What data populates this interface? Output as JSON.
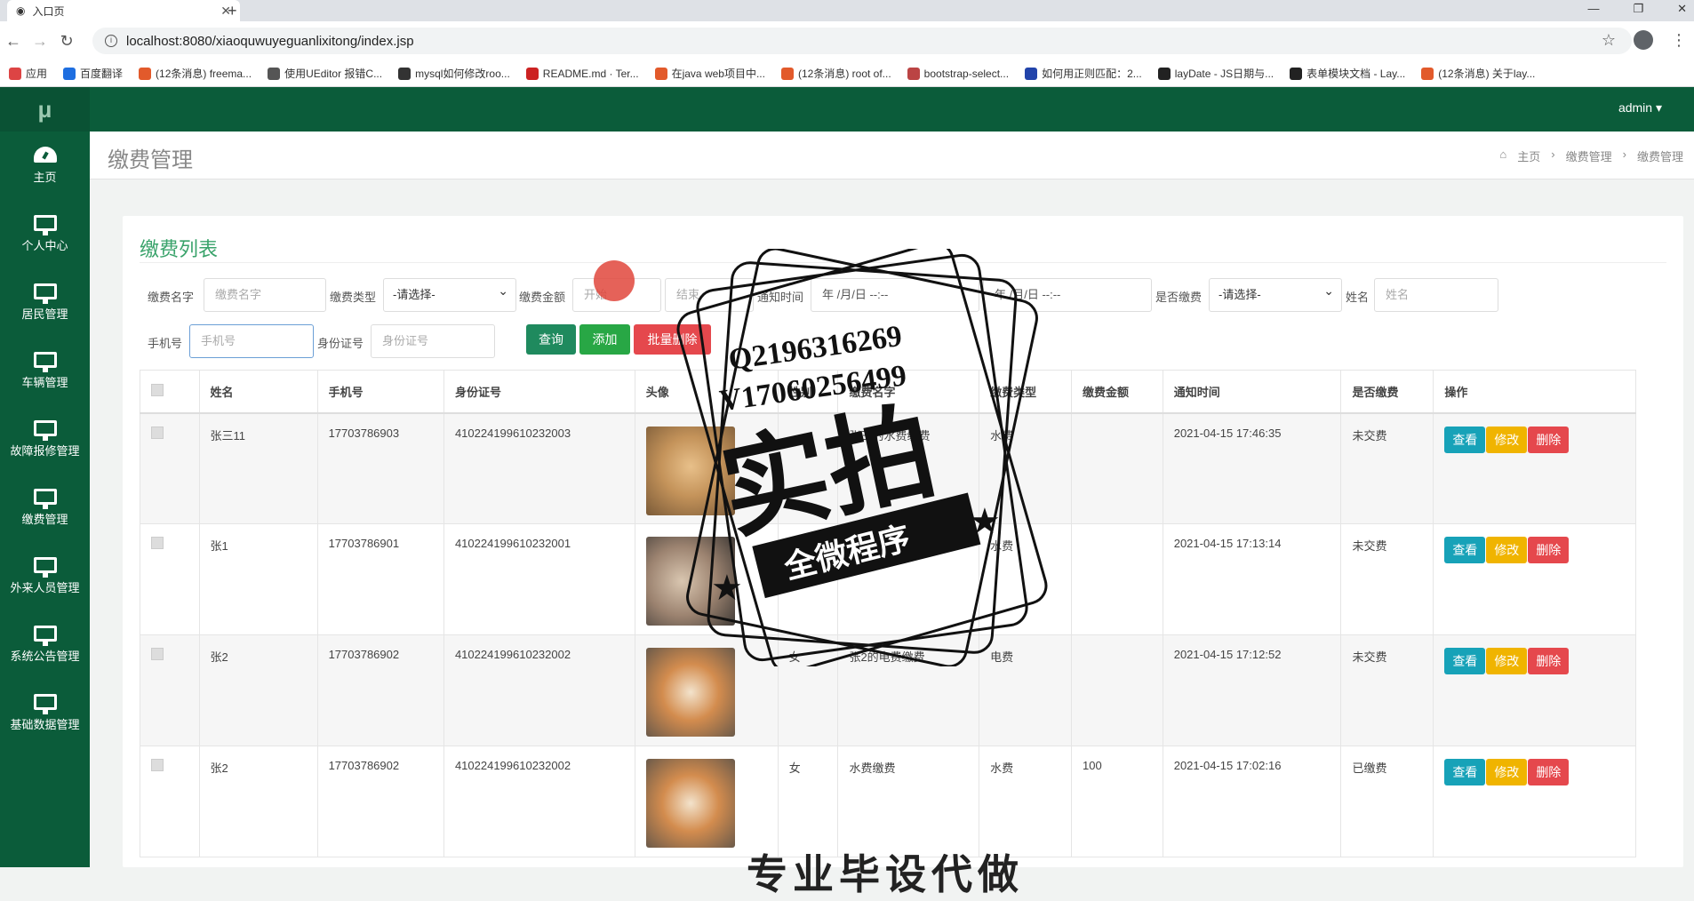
{
  "browser": {
    "tab_title": "入口页",
    "url": "localhost:8080/xiaoquwuyeguanlixitong/index.jsp",
    "bookmarks": [
      "应用",
      "百度翻译",
      "(12条消息) freema...",
      "使用UEditor 报错C...",
      "mysql如何修改roo...",
      "README.md · Ter...",
      "在java web项目中...",
      "(12条消息) root of...",
      "bootstrap-select...",
      "如何用正则匹配：2...",
      "layDate - JS日期与...",
      "表单模块文档 - Lay...",
      "(12条消息) 关于lay..."
    ]
  },
  "app": {
    "logo": "μ",
    "user": "admin",
    "sidebar": [
      {
        "label": "主页",
        "icon": "dashboard-icon"
      },
      {
        "label": "个人中心",
        "icon": "monitor-icon"
      },
      {
        "label": "居民管理",
        "icon": "monitor-icon"
      },
      {
        "label": "车辆管理",
        "icon": "monitor-icon"
      },
      {
        "label": "故障报修管理",
        "icon": "monitor-icon"
      },
      {
        "label": "缴费管理",
        "icon": "monitor-icon"
      },
      {
        "label": "外来人员管理",
        "icon": "monitor-icon"
      },
      {
        "label": "系统公告管理",
        "icon": "monitor-icon"
      },
      {
        "label": "基础数据管理",
        "icon": "monitor-icon"
      }
    ],
    "page_title": "缴费管理",
    "breadcrumb": [
      "主页",
      "缴费管理",
      "缴费管理"
    ]
  },
  "list": {
    "title": "缴费列表",
    "filters": {
      "name_label": "缴费名字",
      "name_placeholder": "缴费名字",
      "type_label": "缴费类型",
      "type_value": "-请选择-",
      "amount_label": "缴费金额",
      "amount_start": "开始",
      "amount_end": "结束",
      "time_label": "通知时间",
      "time_start": "年 /月/日 --:--",
      "time_end": "年 /月/日 --:--",
      "paid_label": "是否缴费",
      "paid_value": "-请选择-",
      "person_label": "姓名",
      "person_placeholder": "姓名",
      "phone_label": "手机号",
      "phone_placeholder": "手机号",
      "id_label": "身份证号",
      "id_placeholder": "身份证号"
    },
    "buttons": {
      "search": "查询",
      "add": "添加",
      "batch_delete": "批量删除"
    },
    "columns": [
      "姓名",
      "手机号",
      "身份证号",
      "头像",
      "性别",
      "缴费名字",
      "缴费类型",
      "缴费金额",
      "通知时间",
      "是否缴费",
      "操作"
    ],
    "rows": [
      {
        "name": "张三11",
        "phone": "17703786903",
        "idno": "410224199610232003",
        "gender": "",
        "fee_name": "张三的水费缴费",
        "fee_type": "水费",
        "amount": "",
        "time": "2021-04-15 17:46:35",
        "paid": "未交费"
      },
      {
        "name": "张1",
        "phone": "17703786901",
        "idno": "410224199610232001",
        "gender": "女",
        "fee_name": "",
        "fee_type": "水费",
        "amount": "",
        "time": "2021-04-15 17:13:14",
        "paid": "未交费"
      },
      {
        "name": "张2",
        "phone": "17703786902",
        "idno": "410224199610232002",
        "gender": "女",
        "fee_name": "张2的电费缴费",
        "fee_type": "电费",
        "amount": "",
        "time": "2021-04-15 17:12:52",
        "paid": "未交费"
      },
      {
        "name": "张2",
        "phone": "17703786902",
        "idno": "410224199610232002",
        "gender": "女",
        "fee_name": "水费缴费",
        "fee_type": "水费",
        "amount": "100",
        "time": "2021-04-15 17:02:16",
        "paid": "已缴费"
      }
    ],
    "row_actions": {
      "view": "查看",
      "edit": "修改",
      "delete": "删除"
    }
  },
  "watermark": {
    "line1": "Q2196316269",
    "line2": "V17060256499",
    "big": "实拍",
    "banner": "全微程序",
    "bottom": "专业毕设代做"
  },
  "colors": {
    "sidebar": "#0b5c3a",
    "accent": "#3aa36b",
    "view": "#17a2b8",
    "edit": "#f0b400",
    "delete": "#e5484d",
    "search": "#1f8a5e"
  }
}
